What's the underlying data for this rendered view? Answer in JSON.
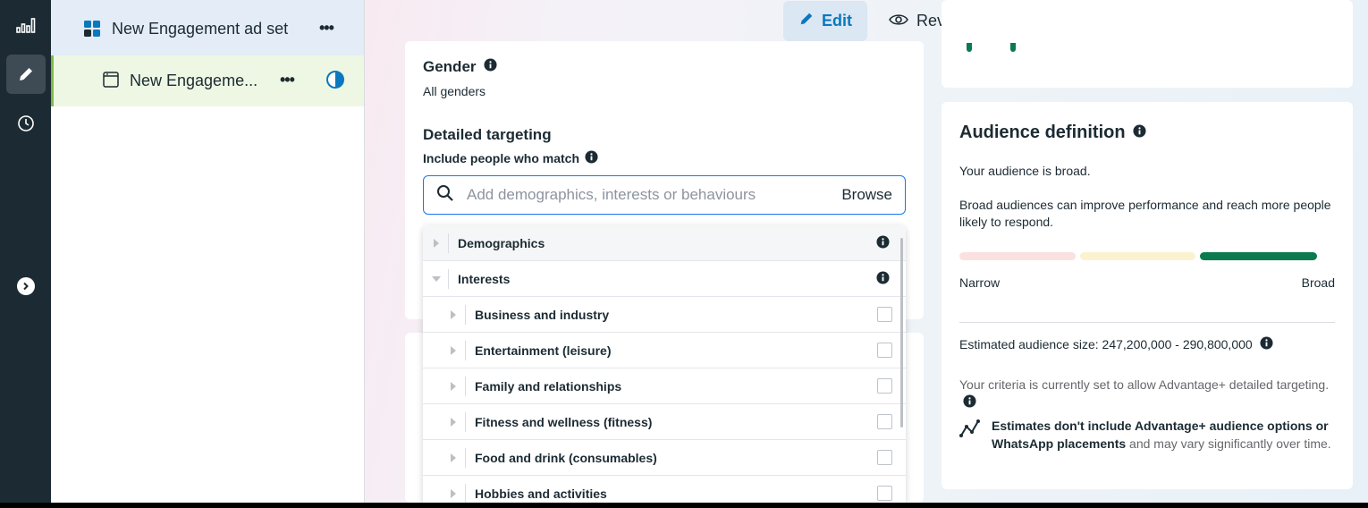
{
  "tree": {
    "adset_label": "New Engagement ad set",
    "ad_label": "New Engageme...",
    "more": "•••"
  },
  "topbar": {
    "edit_label": "Edit",
    "review_label": "Review"
  },
  "targeting": {
    "gender_title": "Gender",
    "gender_value": "All genders",
    "detailed_title": "Detailed targeting",
    "include_label": "Include people who match",
    "search_placeholder": "Add demographics, interests or behaviours",
    "browse_label": "Browse"
  },
  "dropdown": {
    "categories": [
      {
        "label": "Demographics",
        "state": "collapsed"
      },
      {
        "label": "Interests",
        "state": "expanded"
      }
    ],
    "interest_items": [
      "Business and industry",
      "Entertainment (leisure)",
      "Family and relationships",
      "Fitness and wellness (fitness)",
      "Food and drink (consumables)",
      "Hobbies and activities"
    ]
  },
  "audience": {
    "title": "Audience definition",
    "status": "Your audience is broad.",
    "description": "Broad audiences can improve performance and reach more people likely to respond.",
    "narrow_label": "Narrow",
    "broad_label": "Broad",
    "size_text": "Estimated audience size: 247,200,000 - 290,800,000",
    "advantage_text": "Your criteria is currently set to allow Advantage+ detailed targeting.",
    "estimate_bold": "Estimates don't include Advantage+ audience options or WhatsApp placements",
    "estimate_rest": " and may vary significantly over time.",
    "meter_level": "broad",
    "colors": {
      "narrow": "#fbe0e0",
      "mid": "#fbf3cf",
      "broad": "#0b7a4e"
    }
  },
  "colors": {
    "accent": "#0a78be",
    "rail": "#1c2b33"
  }
}
